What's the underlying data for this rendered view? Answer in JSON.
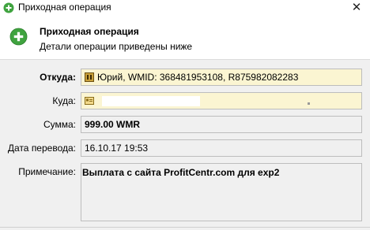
{
  "window": {
    "title": "Приходная операция",
    "icon": "plus-circle-icon",
    "close_glyph": "✕"
  },
  "header": {
    "title": "Приходная операция",
    "subtitle": "Детали операции приведены ниже",
    "icon": "plus-circle-icon"
  },
  "fields": {
    "from_label": "Откуда:",
    "from_value": "Юрий, WMID: 368481953108, R875982082283",
    "to_label": "Куда:",
    "to_value": "",
    "amount_label": "Сумма:",
    "amount_value": "999.00 WMR",
    "date_label": "Дата перевода:",
    "date_value": "16.10.17 19:53",
    "note_label": "Примечание:",
    "note_value": "Выплата с сайта ProfitCentr.com для exp2"
  },
  "colors": {
    "accent_green": "#3fa33f",
    "field_yellow": "#fbf5d2",
    "field_grey": "#f0f0f0"
  }
}
